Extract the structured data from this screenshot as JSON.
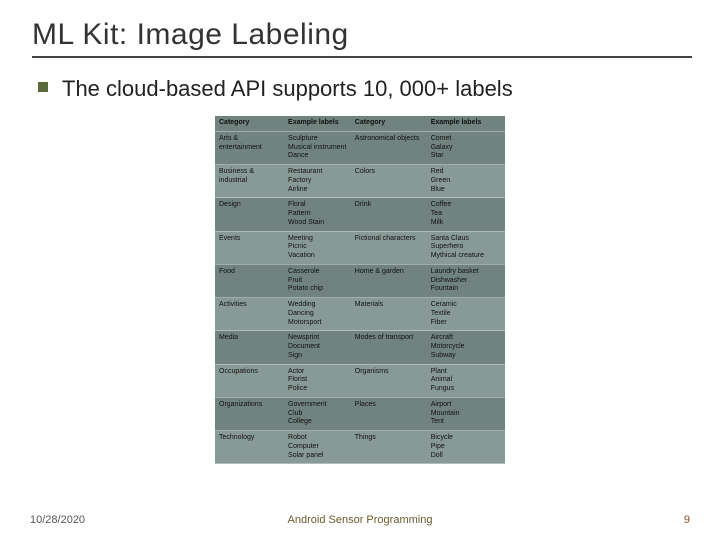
{
  "title": "ML Kit: Image Labeling",
  "bullet": "The cloud-based API supports 10, 000+ labels",
  "headers": {
    "cat1": "Category",
    "ex1": "Example labels",
    "cat2": "Category",
    "ex2": "Example labels"
  },
  "rows": [
    {
      "c1": "Arts & entertainment",
      "e1": "Sculpture\nMusical instrument\nDance",
      "c2": "Astronomical objects",
      "e2": "Comet\nGalaxy\nStar"
    },
    {
      "c1": "Business & industrial",
      "e1": "Restaurant\nFactory\nAirline",
      "c2": "Colors",
      "e2": "Red\nGreen\nBlue"
    },
    {
      "c1": "Design",
      "e1": "Floral\nPattern\nWood Stain",
      "c2": "Drink",
      "e2": "Coffee\nTea\nMilk"
    },
    {
      "c1": "Events",
      "e1": "Meeting\nPicnic\nVacation",
      "c2": "Fictional characters",
      "e2": "Santa Claus\nSuperhero\nMythical creature"
    },
    {
      "c1": "Food",
      "e1": "Casserole\nFruit\nPotato chip",
      "c2": "Home & garden",
      "e2": "Laundry basket\nDishwasher\nFountain"
    },
    {
      "c1": "Activities",
      "e1": "Wedding\nDancing\nMotorsport",
      "c2": "Materials",
      "e2": "Ceramic\nTextile\nFiber"
    },
    {
      "c1": "Media",
      "e1": "Newsprint\nDocument\nSign",
      "c2": "Modes of transport",
      "e2": "Aircraft\nMotorcycle\nSubway"
    },
    {
      "c1": "Occupations",
      "e1": "Actor\nFlorist\nPolice",
      "c2": "Organisms",
      "e2": "Plant\nAnimal\nFungus"
    },
    {
      "c1": "Organizations",
      "e1": "Government\nClub\nCollege",
      "c2": "Places",
      "e2": "Airport\nMountain\nTent"
    },
    {
      "c1": "Technology",
      "e1": "Robot\nComputer\nSolar panel",
      "c2": "Things",
      "e2": "Bicycle\nPipe\nDoll"
    }
  ],
  "footer": {
    "date": "10/28/2020",
    "center": "Android Sensor Programming",
    "page": "9"
  }
}
